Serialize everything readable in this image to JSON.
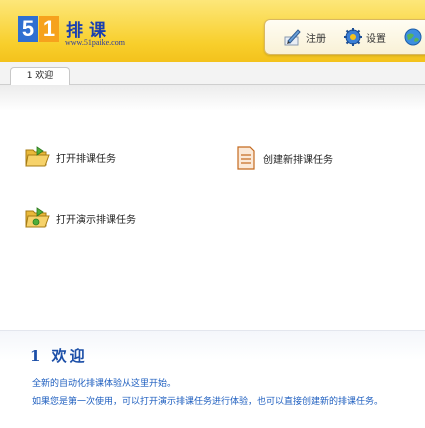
{
  "header": {
    "logo_digit1": "5",
    "logo_digit2": "1",
    "logo_title": "排课",
    "logo_url": "www.51paike.com"
  },
  "toolbar": {
    "register_label": "注册",
    "settings_label": "设置"
  },
  "tabs": [
    {
      "label": "1 欢迎"
    }
  ],
  "tasks": {
    "open_label": "打开排课任务",
    "new_label": "创建新排课任务",
    "demo_label": "打开演示排课任务"
  },
  "welcome": {
    "title": "1 欢迎",
    "line1": "全新的自动化排课体验从这里开始。",
    "line2": "如果您是第一次使用，可以打开演示排课任务进行体验，也可以直接创建新的排课任务。"
  },
  "colors": {
    "header_top": "#fde77a",
    "header_bottom": "#f3c21c",
    "accent_blue": "#1c4fa8",
    "text_blue": "#2060c0"
  },
  "icons": [
    "pen-icon",
    "gear-icon",
    "globe-icon",
    "folder-open-icon",
    "document-icon",
    "folder-demo-icon"
  ]
}
